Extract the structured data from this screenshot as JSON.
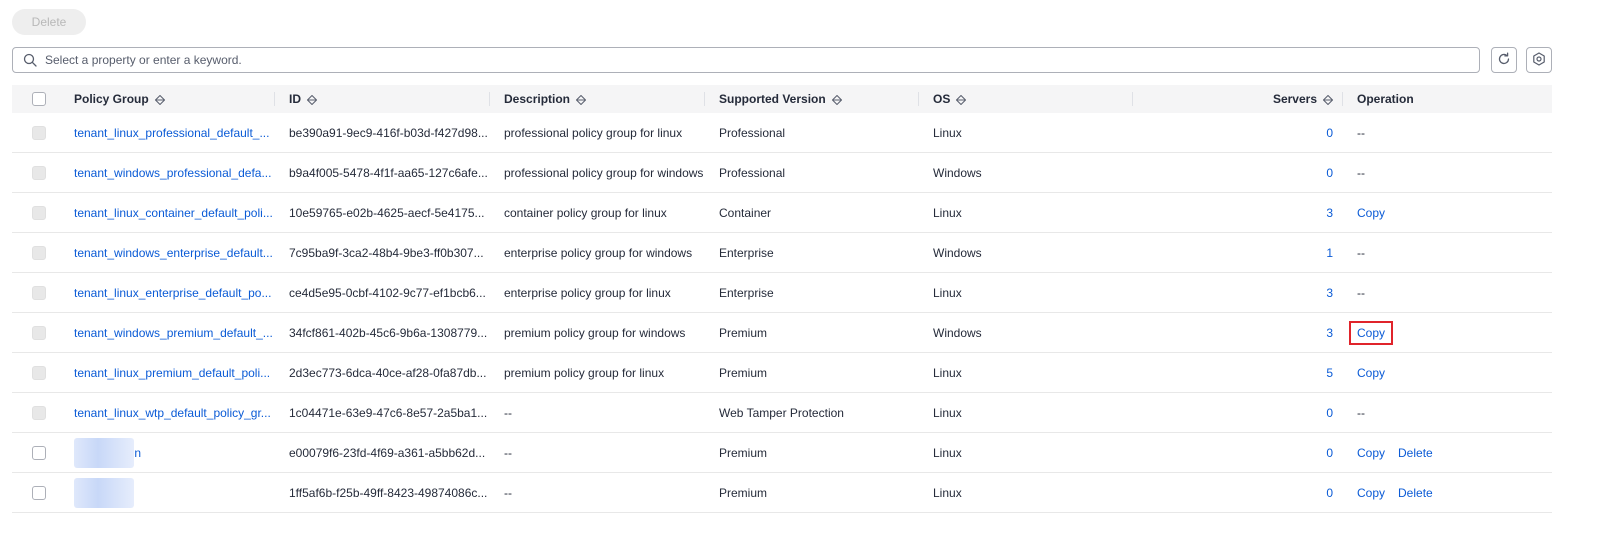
{
  "toolbar": {
    "delete_label": "Delete"
  },
  "search": {
    "placeholder": "Select a property or enter a keyword."
  },
  "columns": {
    "policy_group": "Policy Group",
    "id": "ID",
    "description": "Description",
    "supported_version": "Supported Version",
    "os": "OS",
    "servers": "Servers",
    "operation": "Operation"
  },
  "rows": [
    {
      "name": "tenant_linux_professional_default_...",
      "id": "be390a91-9ec9-416f-b03d-f427d98...",
      "description": "professional policy group for linux",
      "version": "Professional",
      "os": "Linux",
      "servers": "0",
      "op1": "--",
      "op2": ""
    },
    {
      "name": "tenant_windows_professional_defa...",
      "id": "b9a4f005-5478-4f1f-aa65-127c6afe...",
      "description": "professional policy group for windows",
      "version": "Professional",
      "os": "Windows",
      "servers": "0",
      "op1": "--",
      "op2": ""
    },
    {
      "name": "tenant_linux_container_default_poli...",
      "id": "10e59765-e02b-4625-aecf-5e4175...",
      "description": "container policy group for linux",
      "version": "Container",
      "os": "Linux",
      "servers": "3",
      "op1": "Copy",
      "op2": ""
    },
    {
      "name": "tenant_windows_enterprise_default...",
      "id": "7c95ba9f-3ca2-48b4-9be3-ff0b307...",
      "description": "enterprise policy group for windows",
      "version": "Enterprise",
      "os": "Windows",
      "servers": "1",
      "op1": "--",
      "op2": ""
    },
    {
      "name": "tenant_linux_enterprise_default_po...",
      "id": "ce4d5e95-0cbf-4102-9c77-ef1bcb6...",
      "description": "enterprise policy group for linux",
      "version": "Enterprise",
      "os": "Linux",
      "servers": "3",
      "op1": "--",
      "op2": ""
    },
    {
      "name": "tenant_windows_premium_default_...",
      "id": "34fcf861-402b-45c6-9b6a-1308779...",
      "description": "premium policy group for windows",
      "version": "Premium",
      "os": "Windows",
      "servers": "3",
      "op1": "Copy",
      "op2": ""
    },
    {
      "name": "tenant_linux_premium_default_poli...",
      "id": "2d3ec773-6dca-40ce-af28-0fa87db...",
      "description": "premium policy group for linux",
      "version": "Premium",
      "os": "Linux",
      "servers": "5",
      "op1": "Copy",
      "op2": ""
    },
    {
      "name": "tenant_linux_wtp_default_policy_gr...",
      "id": "1c04471e-63e9-47c6-8e57-2a5ba1...",
      "description": "--",
      "version": "Web Tamper Protection",
      "os": "Linux",
      "servers": "0",
      "op1": "--",
      "op2": ""
    },
    {
      "name": "n",
      "id": "e00079f6-23fd-4f69-a361-a5bb62d...",
      "description": "--",
      "version": "Premium",
      "os": "Linux",
      "servers": "0",
      "op1": "Copy",
      "op2": "Delete"
    },
    {
      "name": "",
      "id": "1ff5af6b-f25b-49ff-8423-49874086c...",
      "description": "--",
      "version": "Premium",
      "os": "Linux",
      "servers": "0",
      "op1": "Copy",
      "op2": "Delete"
    }
  ],
  "icons": {
    "search": "search-icon",
    "refresh": "refresh-icon",
    "settings": "gear-icon",
    "sort": "sort-icon"
  },
  "colors": {
    "link": "#0b5bd6",
    "highlight": "#e0242b"
  }
}
